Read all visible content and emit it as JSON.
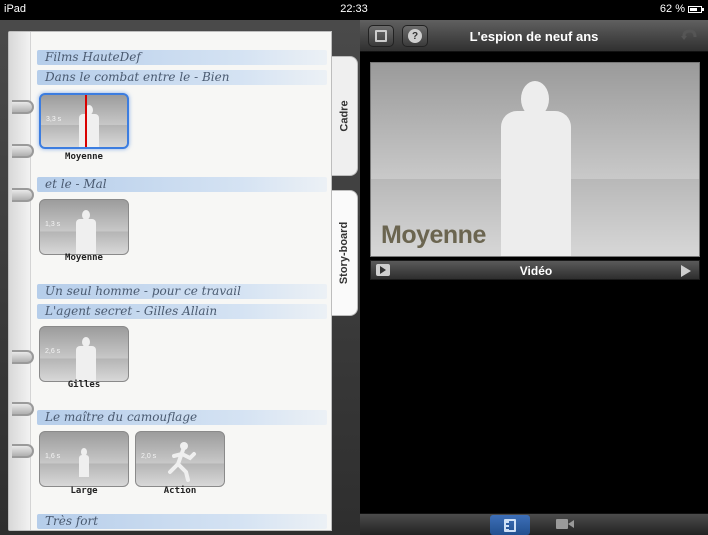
{
  "status_bar": {
    "device": "iPad",
    "time": "22:33",
    "battery": "62 %"
  },
  "header": {
    "title": "L'espion de neuf ans"
  },
  "storyboard": {
    "sections": [
      "Films HauteDef",
      "Dans le combat entre le - Bien",
      "et le - Mal",
      "Un seul homme - pour ce travail",
      "L'agent secret - Gilles Allain",
      "Le maître du camouflage",
      "Très fort"
    ],
    "clips": [
      {
        "duration": "3,3 s",
        "label": "Moyenne"
      },
      {
        "duration": "1,3 s",
        "label": "Moyenne"
      },
      {
        "duration": "2,6 s",
        "label": "Gilles"
      },
      {
        "duration": "1,6 s",
        "label": "Large"
      },
      {
        "duration": "2,0 s",
        "label": "Action"
      }
    ],
    "tabs": {
      "frame": "Cadre",
      "storyboard": "Story-board"
    }
  },
  "preview": {
    "shot_label": "Moyenne"
  },
  "video_bar": {
    "label": "Vidéo"
  },
  "icons": [
    "trim-icon",
    "help-icon",
    "undo-icon",
    "play-icon",
    "next-icon",
    "filmstrip-icon",
    "video-camera-icon",
    "ring-icon"
  ],
  "colors": {
    "accent": "#3c7de0",
    "playhead": "#d90000",
    "strip": "#aac6e8"
  }
}
